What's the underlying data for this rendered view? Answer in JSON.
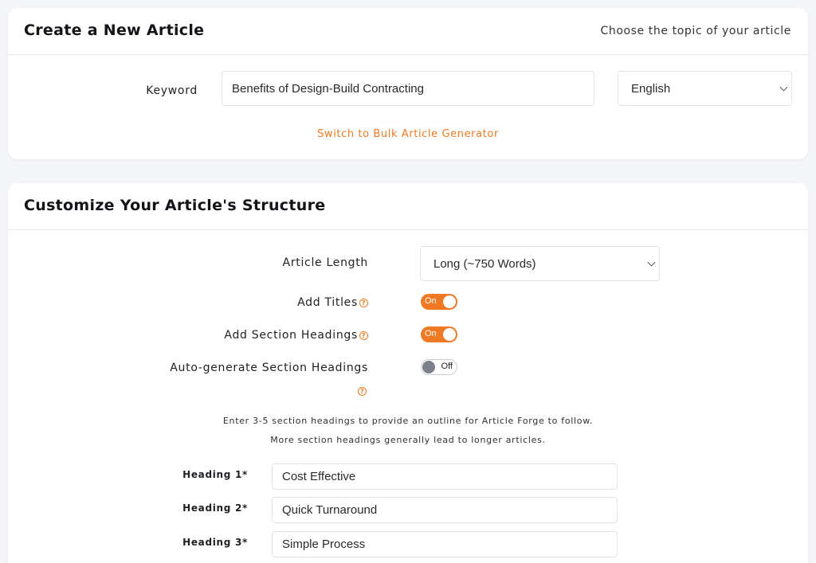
{
  "create_card": {
    "title": "Create a New Article",
    "subtitle": "Choose the topic of your article",
    "keyword_label": "Keyword",
    "keyword_value": "Benefits of Design-Build Contracting",
    "language_value": "English",
    "bulk_link": "Switch to Bulk Article Generator"
  },
  "structure_card": {
    "title": "Customize Your Article's Structure",
    "article_length_label": "Article Length",
    "article_length_value": "Long (~750 Words)",
    "add_titles_label": "Add Titles",
    "add_titles_state": "On",
    "add_section_headings_label": "Add Section Headings",
    "add_section_headings_state": "On",
    "auto_generate_label": "Auto-generate Section Headings",
    "auto_generate_state": "Off",
    "help_glyph": "?",
    "info_line_1": "Enter 3-5 section headings to provide an outline for Article Forge to follow.",
    "info_line_2": "More section headings generally lead to longer articles.",
    "headings": [
      {
        "label": "Heading 1*",
        "value": "Cost Effective"
      },
      {
        "label": "Heading 2*",
        "value": "Quick Turnaround"
      },
      {
        "label": "Heading 3*",
        "value": "Simple Process"
      }
    ]
  },
  "colors": {
    "accent": "#f07a24",
    "background": "#f4f5f9",
    "toggle_off_knob": "#7c8088"
  },
  "icons": {
    "help": "question-circle-icon",
    "dropdown": "chevron-down-icon"
  }
}
